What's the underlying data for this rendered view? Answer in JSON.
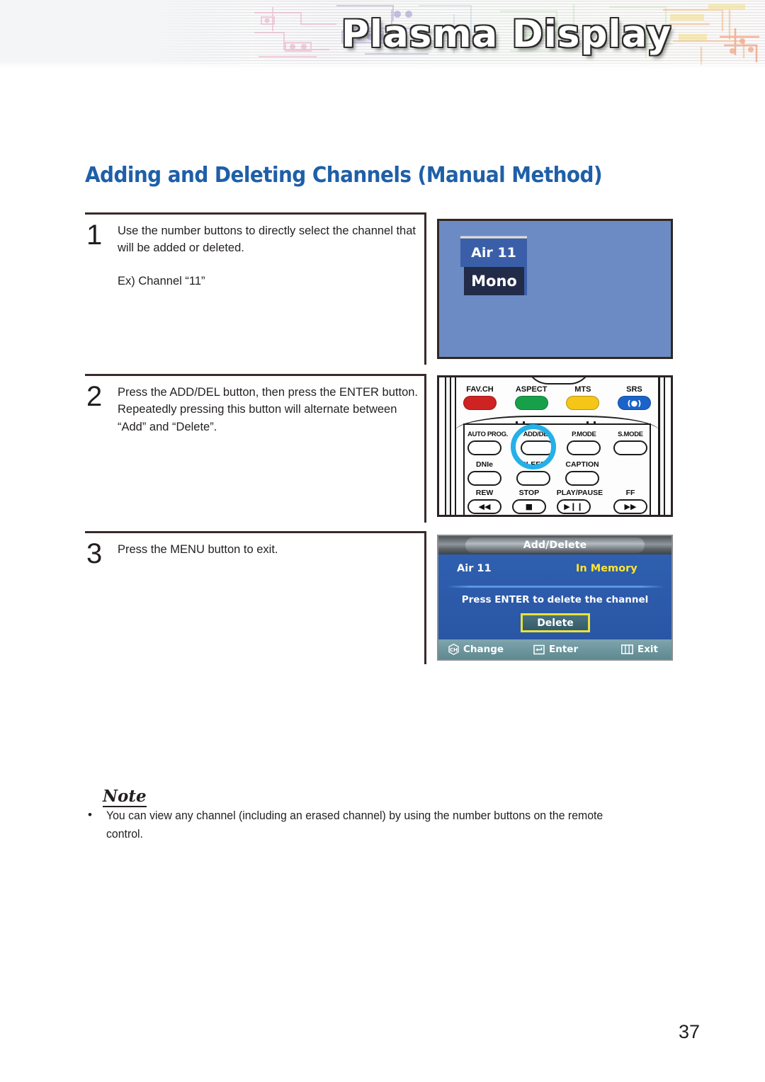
{
  "banner": {
    "title": "Plasma Display",
    "texture_colors": {
      "silver": "#eceef0",
      "pink": "#e9a9c4",
      "purple": "#b9a6d6",
      "green": "#bfe0a8",
      "yellow": "#f2e6a0",
      "orange": "#f2a97a"
    }
  },
  "page": {
    "title": "Adding and Deleting Channels (Manual Method)",
    "title_color": "#1f5fa8",
    "number": "37"
  },
  "steps": [
    {
      "number": "1",
      "text": "Use the number buttons to directly select the channel that will be added or deleted.",
      "extra": "Ex) Channel “11”"
    },
    {
      "number": "2",
      "text": "Press the ADD/DEL button, then press the ENTER button. Repeatedly pressing this button will alternate between “Add” and “Delete”.",
      "extra": ""
    },
    {
      "number": "3",
      "text": "Press the MENU button to exit.",
      "extra": ""
    }
  ],
  "tv_figure": {
    "channel_label": "Air 11",
    "audio_mode": "Mono",
    "screen_color": "#6c8bc4",
    "channel_box_color": "#3a5fa8",
    "audio_box_color": "#222b48"
  },
  "remote_figure": {
    "color_keys": [
      {
        "label": "FAV.CH",
        "color": "#cf2222",
        "glyph": ""
      },
      {
        "label": "ASPECT",
        "color": "#17a04a",
        "glyph": ""
      },
      {
        "label": "MTS",
        "color": "#f5c518",
        "glyph": ""
      },
      {
        "label": "SRS",
        "color": "#1b63c9",
        "glyph": "(●)"
      }
    ],
    "row1": [
      {
        "label": "AUTO PROG.",
        "glyph": ""
      },
      {
        "label": "ADD/DEL",
        "glyph": ""
      },
      {
        "label": "P.MODE",
        "glyph": ""
      },
      {
        "label": "S.MODE",
        "glyph": ""
      }
    ],
    "row2": [
      {
        "label": "DNIe",
        "glyph": ""
      },
      {
        "label": "SLEEP",
        "glyph": ""
      },
      {
        "label": "CAPTION",
        "glyph": ""
      }
    ],
    "row3": [
      {
        "label": "REW",
        "glyph": "◀◀"
      },
      {
        "label": "STOP",
        "glyph": "■"
      },
      {
        "label": "PLAY/PAUSE",
        "glyph": "▶❙❙"
      },
      {
        "label": "FF",
        "glyph": "▶▶"
      }
    ],
    "highlight": {
      "target": "ADD/DEL",
      "color": "#25b0e8"
    }
  },
  "osd_figure": {
    "title": "Add/Delete",
    "channel": "Air  11",
    "status": "In Memory",
    "status_color": "#ffe62e",
    "prompt": "Press ENTER to delete the channel",
    "action_button": "Delete",
    "action_border_color": "#e8e23c",
    "footer": [
      {
        "icon": "channel-hex-icon",
        "label": "Change"
      },
      {
        "icon": "enter-arrow-icon",
        "label": "Enter"
      },
      {
        "icon": "menu-grid-icon",
        "label": "Exit"
      }
    ]
  },
  "note": {
    "heading": "Note",
    "bullet": "•",
    "text": "You can view any channel (including an erased channel) by using the number buttons on the remote control."
  }
}
